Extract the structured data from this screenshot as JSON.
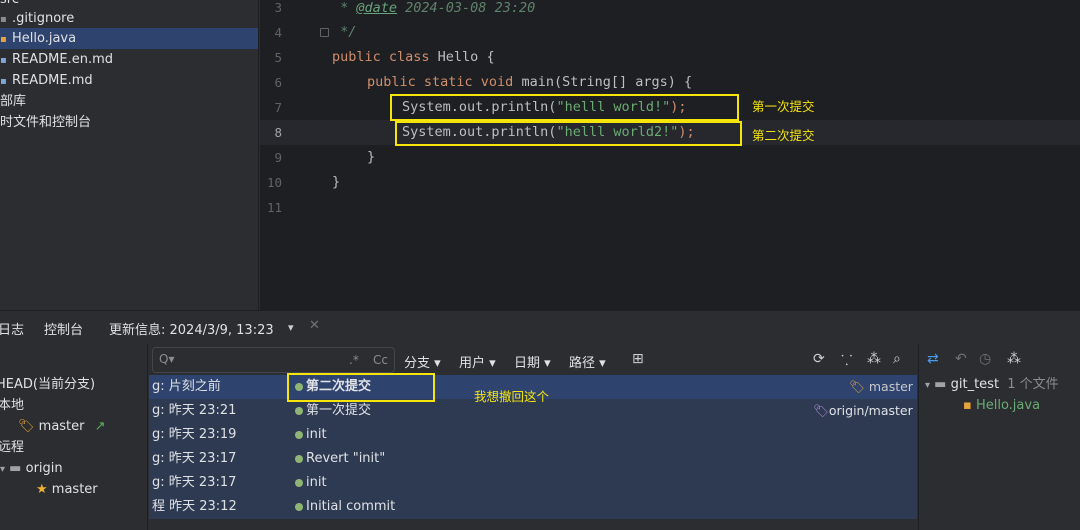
{
  "project_tree": {
    "items": [
      {
        "label": "src"
      },
      {
        "label": ".gitignore"
      },
      {
        "label": "Hello.java"
      },
      {
        "label": "README.en.md"
      },
      {
        "label": "README.md"
      },
      {
        "label": "部库"
      },
      {
        "label": "时文件和控制台"
      }
    ]
  },
  "editor": {
    "line_numbers": [
      "3",
      "4",
      "5",
      "6",
      "7",
      "8",
      "9",
      "10",
      "11"
    ],
    "lines": {
      "l3_prefix": " * ",
      "l3_tag": "@date",
      "l3_rest": " 2024-03-08 23:20",
      "l4": " */",
      "l5_kw": "public class",
      "l5_rest": " Hello {",
      "l6_kw": "public static void",
      "l6_rest": " main(String[] args) {",
      "l7_code": "System.out.println(",
      "l7_str": "\"helll world!\"",
      "l7_end": ");",
      "l8_code": "System.out.println(",
      "l8_str": "\"helll world2!\"",
      "l8_end": ");",
      "l9": "}",
      "l10": "}"
    },
    "annotations": {
      "first_commit": "第一次提交",
      "second_commit": "第二次提交"
    }
  },
  "bottom_panel": {
    "tabs": {
      "log": "日志",
      "console": "控制台",
      "update_info": "更新信息: 2024/3/9, 13:23"
    },
    "branches": {
      "head": "HEAD(当前分支)",
      "local": "本地",
      "master": "master",
      "remote": "远程",
      "origin": "origin",
      "origin_master": "master"
    },
    "log": {
      "search_placeholder": "Q▾",
      "regex": ".*",
      "case": "Cc",
      "filters": {
        "branch": "分支 ▾",
        "user": "用户 ▾",
        "date": "日期 ▾",
        "path": "路径 ▾"
      },
      "commits": [
        {
          "author": "g: 片刻之前",
          "message": "第二次提交",
          "tag": "master"
        },
        {
          "author": "g: 昨天 23:21",
          "message": "第一次提交",
          "tag": "origin/master"
        },
        {
          "author": "g: 昨天 23:19",
          "message": "init",
          "tag": ""
        },
        {
          "author": "g: 昨天 23:17",
          "message": "Revert \"init\"",
          "tag": ""
        },
        {
          "author": "g: 昨天 23:17",
          "message": "init",
          "tag": ""
        },
        {
          "author": "程 昨天 23:12",
          "message": "Initial commit",
          "tag": ""
        }
      ],
      "annotation": "我想撤回这个"
    },
    "changes": {
      "root": "git_test",
      "count": "1 个文件",
      "file": "Hello.java"
    }
  },
  "colors": {
    "accent_selection": "#2e436e",
    "annotation_yellow": "#f5e50a",
    "graph_green": "#8fb573"
  }
}
